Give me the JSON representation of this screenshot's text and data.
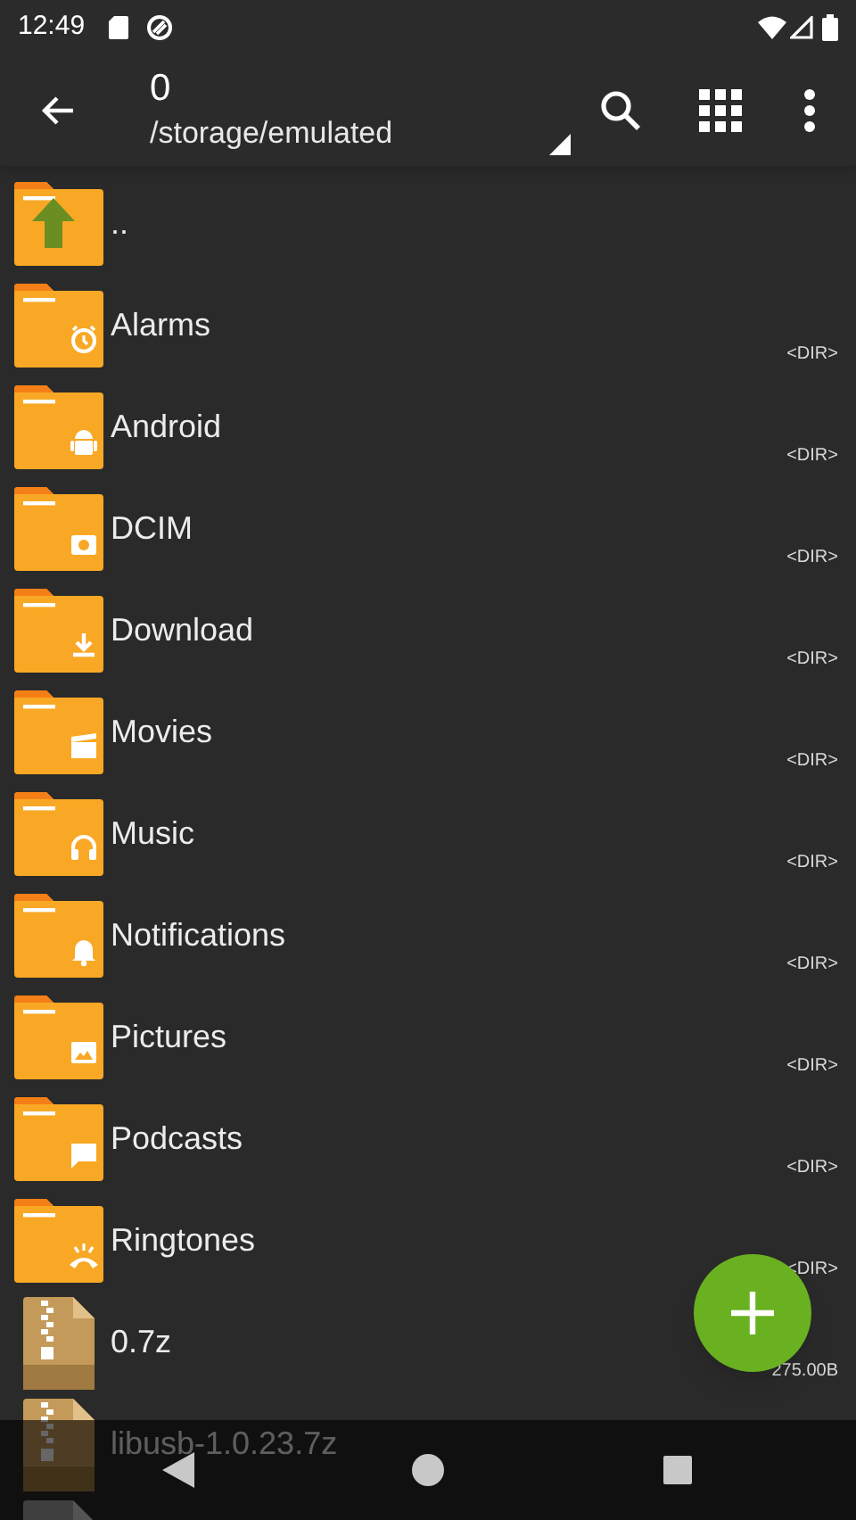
{
  "status_bar": {
    "time": "12:49"
  },
  "toolbar": {
    "title": "0",
    "path": "/storage/emulated"
  },
  "files": [
    {
      "kind": "up",
      "name": ".."
    },
    {
      "kind": "folder",
      "name": "Alarms",
      "size": "<DIR>"
    },
    {
      "kind": "folder",
      "name": "Android",
      "size": "<DIR>"
    },
    {
      "kind": "folder",
      "name": "DCIM",
      "size": "<DIR>"
    },
    {
      "kind": "folder",
      "name": "Download",
      "size": "<DIR>"
    },
    {
      "kind": "folder",
      "name": "Movies",
      "size": "<DIR>"
    },
    {
      "kind": "folder",
      "name": "Music",
      "size": "<DIR>"
    },
    {
      "kind": "folder",
      "name": "Notifications",
      "size": "<DIR>"
    },
    {
      "kind": "folder",
      "name": "Pictures",
      "size": "<DIR>"
    },
    {
      "kind": "folder",
      "name": "Podcasts",
      "size": "<DIR>"
    },
    {
      "kind": "folder",
      "name": "Ringtones",
      "size": "<DIR>"
    },
    {
      "kind": "archive",
      "name": "0.7z",
      "size": "275.00B"
    },
    {
      "kind": "archive",
      "name": "libusb-1.0.23.7z"
    },
    {
      "kind": "file"
    }
  ]
}
